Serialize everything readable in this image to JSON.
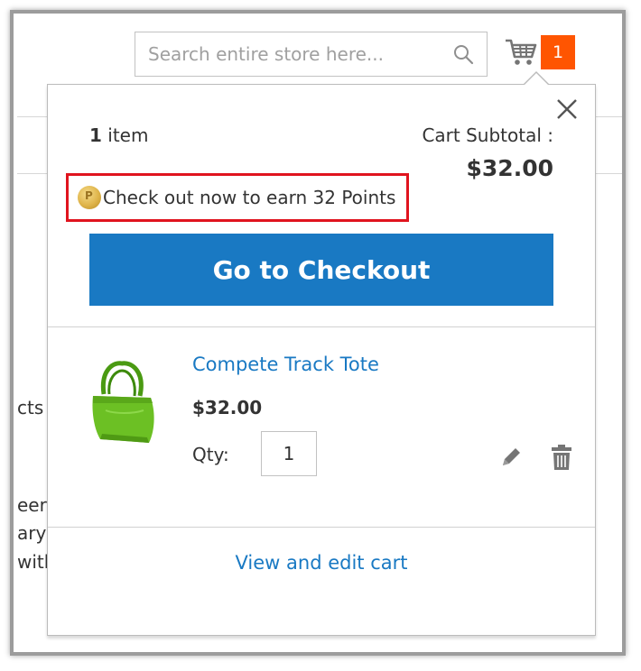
{
  "header": {
    "search_placeholder": "Search entire store here...",
    "cart_count": "1"
  },
  "background_text": [
    "cts",
    "eer",
    "ary",
    "with"
  ],
  "minicart": {
    "items_count_number": "1",
    "items_count_label": "item",
    "subtotal_label": "Cart Subtotal :",
    "subtotal_value": "$32.00",
    "points_message": "Check out now to earn 32 Points",
    "checkout_button": "Go to Checkout",
    "product": {
      "name": "Compete Track Tote",
      "price": "$32.00",
      "qty_label": "Qty:",
      "qty_value": "1"
    },
    "view_edit_link": "View and edit cart"
  },
  "icons": [
    "search-icon",
    "cart-icon",
    "close-icon",
    "points-coin-icon",
    "edit-pencil-icon",
    "trash-icon"
  ],
  "colors": {
    "accent_blue": "#1979c3",
    "cart_badge": "#ff5501",
    "highlight_border": "#e0141e"
  }
}
